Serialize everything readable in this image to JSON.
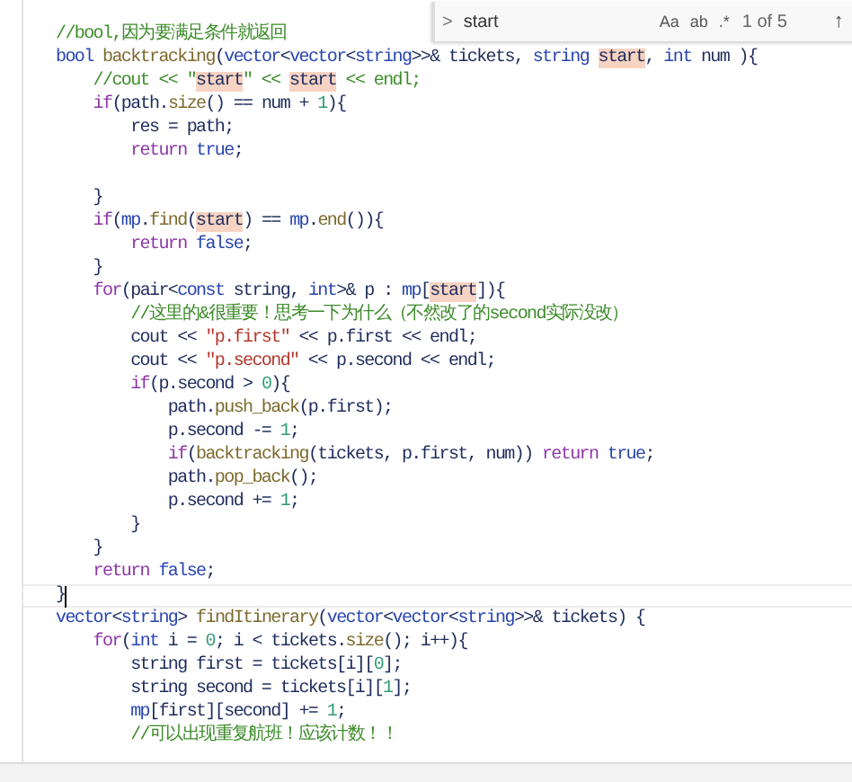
{
  "editor": {
    "lines": [
      {
        "current": false,
        "tokens": [
          {
            "text": "//bool,因为要满足条件就返回",
            "kind": "comment"
          }
        ]
      },
      {
        "current": false,
        "tokens": [
          {
            "text": "bool",
            "kind": "type"
          },
          {
            "text": " backtracking",
            "kind": "function"
          },
          {
            "text": "(",
            "kind": "plain"
          },
          {
            "text": "vector",
            "kind": "type"
          },
          {
            "text": "<",
            "kind": "plain"
          },
          {
            "text": "vector",
            "kind": "type"
          },
          {
            "text": "<",
            "kind": "plain"
          },
          {
            "text": "string",
            "kind": "type"
          },
          {
            "text": ">>& tickets, ",
            "kind": "plain"
          },
          {
            "text": "string ",
            "kind": "type"
          },
          {
            "text": "start",
            "kind": "match"
          },
          {
            "text": ", ",
            "kind": "plain"
          },
          {
            "text": "int",
            "kind": "type"
          },
          {
            "text": " num ){",
            "kind": "plain"
          }
        ]
      },
      {
        "current": false,
        "tokens": [
          {
            "text": "    //cout << \"",
            "kind": "comment"
          },
          {
            "text": "start",
            "kind": "match"
          },
          {
            "text": "\" << ",
            "kind": "comment"
          },
          {
            "text": "start",
            "kind": "match"
          },
          {
            "text": " << endl;",
            "kind": "comment"
          }
        ]
      },
      {
        "current": false,
        "tokens": [
          {
            "text": "    if",
            "kind": "keyword"
          },
          {
            "text": "(path.",
            "kind": "plain"
          },
          {
            "text": "size",
            "kind": "function"
          },
          {
            "text": "() == num + ",
            "kind": "plain"
          },
          {
            "text": "1",
            "kind": "number"
          },
          {
            "text": "){",
            "kind": "plain"
          }
        ]
      },
      {
        "current": false,
        "tokens": [
          {
            "text": "        res = path;",
            "kind": "plain"
          }
        ]
      },
      {
        "current": false,
        "tokens": [
          {
            "text": "        return",
            "kind": "keyword"
          },
          {
            "text": " true",
            "kind": "type"
          },
          {
            "text": ";",
            "kind": "plain"
          }
        ]
      },
      {
        "current": false
      },
      {
        "current": false,
        "tokens": [
          {
            "text": "    }",
            "kind": "plain"
          }
        ]
      },
      {
        "current": false,
        "tokens": [
          {
            "text": "    if",
            "kind": "keyword"
          },
          {
            "text": "(",
            "kind": "plain"
          },
          {
            "text": "mp",
            "kind": "type"
          },
          {
            "text": ".",
            "kind": "plain"
          },
          {
            "text": "find",
            "kind": "function"
          },
          {
            "text": "(",
            "kind": "plain"
          },
          {
            "text": "start",
            "kind": "match"
          },
          {
            "text": ") == ",
            "kind": "plain"
          },
          {
            "text": "mp",
            "kind": "type"
          },
          {
            "text": ".",
            "kind": "plain"
          },
          {
            "text": "end",
            "kind": "function"
          },
          {
            "text": "()){",
            "kind": "plain"
          }
        ]
      },
      {
        "current": false,
        "tokens": [
          {
            "text": "        return",
            "kind": "keyword"
          },
          {
            "text": " false",
            "kind": "type"
          },
          {
            "text": ";",
            "kind": "plain"
          }
        ]
      },
      {
        "current": false,
        "tokens": [
          {
            "text": "    }",
            "kind": "plain"
          }
        ]
      },
      {
        "current": false,
        "tokens": [
          {
            "text": "    for",
            "kind": "keyword"
          },
          {
            "text": "(pair<",
            "kind": "plain"
          },
          {
            "text": "const",
            "kind": "type"
          },
          {
            "text": " string, ",
            "kind": "plain"
          },
          {
            "text": "int",
            "kind": "type"
          },
          {
            "text": ">& p : ",
            "kind": "plain"
          },
          {
            "text": "mp",
            "kind": "type"
          },
          {
            "text": "[",
            "kind": "plain"
          },
          {
            "text": "start",
            "kind": "match"
          },
          {
            "text": "]){",
            "kind": "plain"
          }
        ]
      },
      {
        "current": false,
        "tokens": [
          {
            "text": "        //这里的&很重要！思考一下为什么（不然改了的second实际没改）",
            "kind": "comment"
          }
        ]
      },
      {
        "current": false,
        "tokens": [
          {
            "text": "        cout << ",
            "kind": "plain"
          },
          {
            "text": "\"p.first\"",
            "kind": "string"
          },
          {
            "text": " << p.first << endl;",
            "kind": "plain"
          }
        ]
      },
      {
        "current": false,
        "tokens": [
          {
            "text": "        cout << ",
            "kind": "plain"
          },
          {
            "text": "\"p.second\"",
            "kind": "string"
          },
          {
            "text": " << p.second << endl;",
            "kind": "plain"
          }
        ]
      },
      {
        "current": false,
        "tokens": [
          {
            "text": "        if",
            "kind": "keyword"
          },
          {
            "text": "(p.second > ",
            "kind": "plain"
          },
          {
            "text": "0",
            "kind": "number"
          },
          {
            "text": "){",
            "kind": "plain"
          }
        ]
      },
      {
        "current": false,
        "tokens": [
          {
            "text": "            path.",
            "kind": "plain"
          },
          {
            "text": "push_back",
            "kind": "function"
          },
          {
            "text": "(p.first);",
            "kind": "plain"
          }
        ]
      },
      {
        "current": false,
        "tokens": [
          {
            "text": "            p.second -= ",
            "kind": "plain"
          },
          {
            "text": "1",
            "kind": "number"
          },
          {
            "text": ";",
            "kind": "plain"
          }
        ]
      },
      {
        "current": false,
        "tokens": [
          {
            "text": "            if",
            "kind": "keyword"
          },
          {
            "text": "(",
            "kind": "plain"
          },
          {
            "text": "backtracking",
            "kind": "function"
          },
          {
            "text": "(tickets, p.first, num)) ",
            "kind": "plain"
          },
          {
            "text": "return",
            "kind": "keyword"
          },
          {
            "text": " true",
            "kind": "type"
          },
          {
            "text": ";",
            "kind": "plain"
          }
        ]
      },
      {
        "current": false,
        "tokens": [
          {
            "text": "            path.",
            "kind": "plain"
          },
          {
            "text": "pop_back",
            "kind": "function"
          },
          {
            "text": "();",
            "kind": "plain"
          }
        ]
      },
      {
        "current": false,
        "tokens": [
          {
            "text": "            p.second += ",
            "kind": "plain"
          },
          {
            "text": "1",
            "kind": "number"
          },
          {
            "text": ";",
            "kind": "plain"
          }
        ]
      },
      {
        "current": false,
        "tokens": [
          {
            "text": "        }",
            "kind": "plain"
          }
        ]
      },
      {
        "current": false,
        "tokens": [
          {
            "text": "    }",
            "kind": "plain"
          }
        ]
      },
      {
        "current": false,
        "tokens": [
          {
            "text": "    return",
            "kind": "keyword"
          },
          {
            "text": " false",
            "kind": "type"
          },
          {
            "text": ";",
            "kind": "plain"
          }
        ]
      },
      {
        "current": true,
        "tokens": [
          {
            "text": "}",
            "kind": "plain"
          }
        ]
      },
      {
        "current": false,
        "tokens": [
          {
            "text": "vector",
            "kind": "type"
          },
          {
            "text": "<",
            "kind": "plain"
          },
          {
            "text": "string",
            "kind": "type"
          },
          {
            "text": "> ",
            "kind": "plain"
          },
          {
            "text": "findItinerary",
            "kind": "function"
          },
          {
            "text": "(",
            "kind": "plain"
          },
          {
            "text": "vector",
            "kind": "type"
          },
          {
            "text": "<",
            "kind": "plain"
          },
          {
            "text": "vector",
            "kind": "type"
          },
          {
            "text": "<",
            "kind": "plain"
          },
          {
            "text": "string",
            "kind": "type"
          },
          {
            "text": ">>& tickets) {",
            "kind": "plain"
          }
        ]
      },
      {
        "current": false,
        "tokens": [
          {
            "text": "    for",
            "kind": "keyword"
          },
          {
            "text": "(",
            "kind": "plain"
          },
          {
            "text": "int",
            "kind": "type"
          },
          {
            "text": " i = ",
            "kind": "plain"
          },
          {
            "text": "0",
            "kind": "number"
          },
          {
            "text": "; i < tickets.",
            "kind": "plain"
          },
          {
            "text": "size",
            "kind": "function"
          },
          {
            "text": "(); i++){",
            "kind": "plain"
          }
        ]
      },
      {
        "current": false,
        "tokens": [
          {
            "text": "        string first = tickets[i][",
            "kind": "plain"
          },
          {
            "text": "0",
            "kind": "number"
          },
          {
            "text": "];",
            "kind": "plain"
          }
        ]
      },
      {
        "current": false,
        "tokens": [
          {
            "text": "        string second = tickets[i][",
            "kind": "plain"
          },
          {
            "text": "1",
            "kind": "number"
          },
          {
            "text": "];",
            "kind": "plain"
          }
        ]
      },
      {
        "current": false,
        "tokens": [
          {
            "text": "        mp",
            "kind": "type"
          },
          {
            "text": "[first][second] += ",
            "kind": "plain"
          },
          {
            "text": "1",
            "kind": "number"
          },
          {
            "text": ";",
            "kind": "plain"
          }
        ]
      },
      {
        "current": false,
        "tokens": [
          {
            "text": "        //可以出现重复航班！应该计数！！",
            "kind": "comment"
          }
        ]
      }
    ]
  },
  "find": {
    "chevron": ">",
    "value": "start",
    "options": [
      "Aa",
      "ab",
      ".*"
    ],
    "count": "1 of 5",
    "previous": "↑"
  }
}
